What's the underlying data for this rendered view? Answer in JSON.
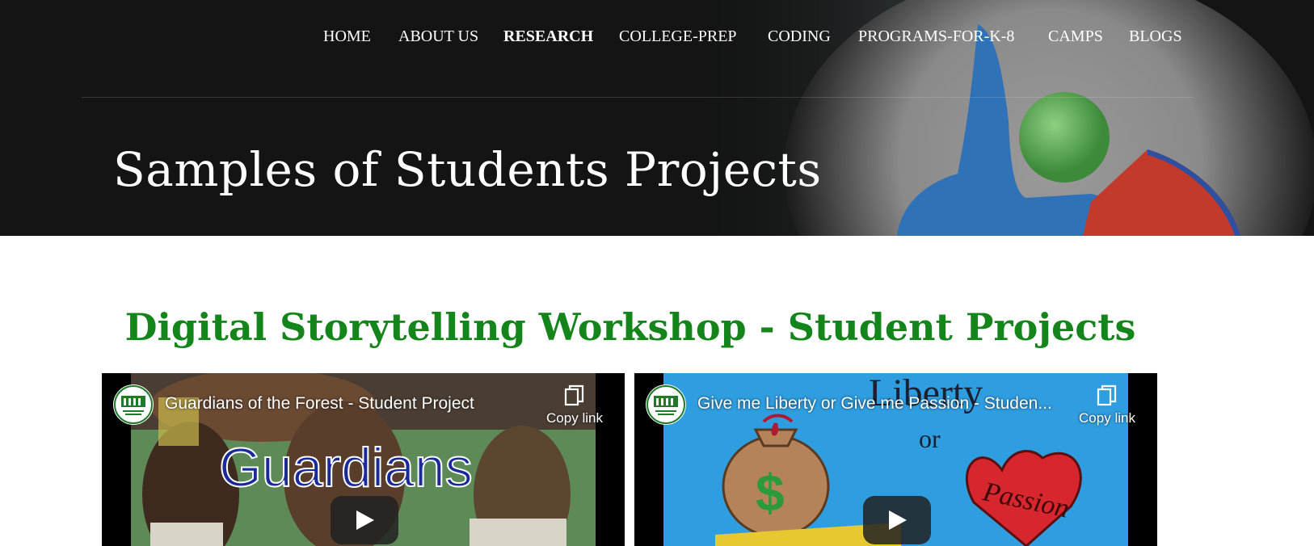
{
  "nav": {
    "items": [
      {
        "label": "HOME",
        "active": false
      },
      {
        "label": "ABOUT US",
        "active": false
      },
      {
        "label": "RESEARCH",
        "active": true
      },
      {
        "label": "COLLEGE-PREP",
        "active": false
      },
      {
        "label": "CODING",
        "active": false
      },
      {
        "label": "PROGRAMS-FOR-K-8",
        "active": false
      },
      {
        "label": "CAMPS",
        "active": false
      },
      {
        "label": "BLOGS",
        "active": false
      }
    ]
  },
  "hero": {
    "title": "Samples of Students Projects"
  },
  "section": {
    "title": "Digital Storytelling Workshop - Student Projects",
    "title_color": "#13851a"
  },
  "videos": [
    {
      "title": "Guardians of the Forest - Student Project",
      "copy_label": "Copy link",
      "thumbnail_text": "Guardians"
    },
    {
      "title": "Give me Liberty or Give me Passion - Studen...",
      "copy_label": "Copy link",
      "thumbnail_text": [
        "Liberty",
        "or",
        "Passion"
      ]
    }
  ],
  "icons": {
    "copy": "copy-link-icon",
    "play": "play-icon",
    "channel": "channel-logo-icon"
  }
}
